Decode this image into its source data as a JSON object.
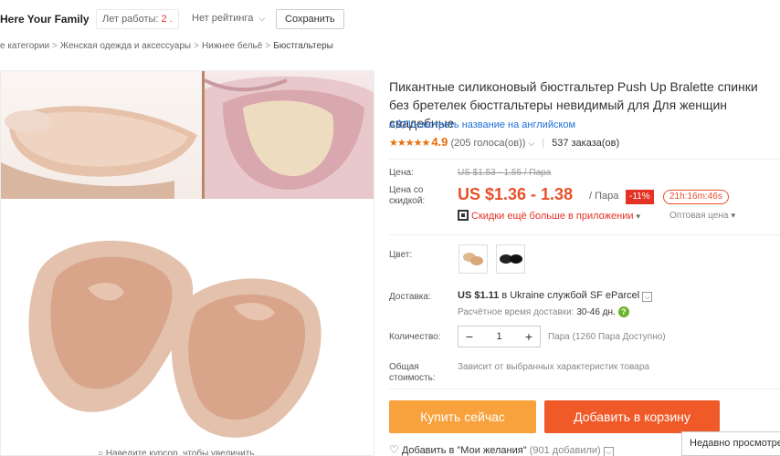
{
  "store": {
    "name": "Here Your Family",
    "years_label": "Лет работы: ",
    "years_value": "2 .",
    "rating_label": "Нет рейтинга",
    "save_label": "Сохранить"
  },
  "breadcrumb": {
    "items": [
      "е категории",
      "Женская одежда и аксессуары",
      "Нижнее бельё",
      "Бюстгальтеры"
    ],
    "separator": ">"
  },
  "image": {
    "zoom_hint": "Наведите курсор, чтобы увеличить"
  },
  "product": {
    "title": "Пикантные силиконовый бюстгальтер Push Up Bralette спинки без бретелек бюстгальтеры невидимый для Для женщин свадебные",
    "translate_label": "Посмотреть название на английском",
    "stars": "★★★★★",
    "rating": "4.9",
    "votes": "(205 голоса(ов))",
    "orders": "537 заказа(ов)"
  },
  "price": {
    "label": "Цена:",
    "old": "US $1.53 - 1.55 / Пара",
    "discount_label": "Цена со скидкой:",
    "current": "US $1.36 - 1.38",
    "unit": "/ Пара",
    "discount": "-11%",
    "timer": "21h:16m:46s",
    "app_discount": "Скидки ещё больше в приложении",
    "wholesale": "Оптовая цена"
  },
  "color": {
    "label": "Цвет:"
  },
  "delivery": {
    "label": "Доставка:",
    "price": "US $1.11",
    "text": " в Ukraine службой SF eParcel",
    "time_label": "Расчётное время доставки: ",
    "time_value": "30-46 дн.",
    "help": "?"
  },
  "quantity": {
    "label": "Количество:",
    "minus": "−",
    "value": "1",
    "plus": "+",
    "note": "Пара (1260 Пара Доступно)"
  },
  "total": {
    "label": "Общая стоимость:",
    "note": "Зависит от выбранных характеристик товара"
  },
  "actions": {
    "buy": "Купить сейчас",
    "cart": "Добавить в корзину",
    "wishlist": "Добавить в \"Мои желания\"",
    "wishlist_count": "(901 добавили)"
  },
  "recent": {
    "label": "Недавно просмотре"
  },
  "colors": {
    "accent": "#e8502a",
    "buy_button": "#f7a23c",
    "cart_button": "#f05a28",
    "rating": "#e8700a"
  }
}
